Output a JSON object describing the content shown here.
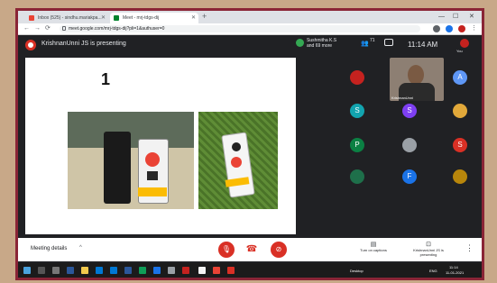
{
  "browser": {
    "tabs": [
      {
        "label": "Inbox (525) - sindhu.mariakpa..."
      },
      {
        "label": "Meet - mrj-tdgs-dij"
      }
    ],
    "url": "meet.google.com/mrj-tdgs-dij?pli=1&authuser=0",
    "back": "←",
    "forward": "→",
    "reload": "⟳",
    "newtab": "+",
    "minimize": "—",
    "maximize": "☐",
    "close": "✕"
  },
  "meet": {
    "presenting_text": "KrishnanUnni JS is presenting",
    "speaker_name_line1": "Sushmitha K.S",
    "speaker_name_line2": "and 69 more",
    "people_count": "71",
    "time": "11:14 AM",
    "you_label": "You",
    "slide_number": "1",
    "self_name": "KrishnanUnni",
    "participants": [
      "",
      "A",
      "S",
      "S",
      "",
      "P",
      "",
      "S",
      "",
      "F",
      ""
    ],
    "colors": {
      "red": "#d93025",
      "accent": "#1a73e8",
      "frame": "#8a2536"
    }
  },
  "controls": {
    "meeting_details": "Meeting details",
    "chevron": "^",
    "mic_icon": "🎙",
    "hangup_icon": "☎",
    "cam_icon": "⊘",
    "captions_label": "Turn on captions",
    "captions_icon": "▤",
    "present_label": "KrishnanUnni JS is presenting",
    "present_icon": "⊡",
    "more_icon": "⋮"
  },
  "taskbar": {
    "time": "11:14",
    "date": "11-01-2021",
    "lang": "ENG",
    "desktop_label": "Desktop"
  }
}
